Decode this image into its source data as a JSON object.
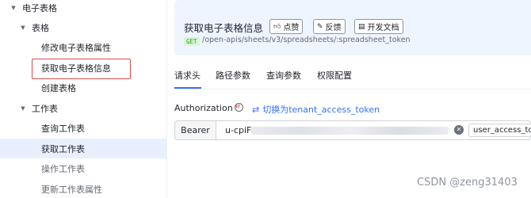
{
  "sidebar": {
    "items": [
      {
        "label": "电子表格",
        "arrow": "▼"
      },
      {
        "label": "表格",
        "arrow": "▼"
      },
      {
        "label": "修改电子表格属性"
      },
      {
        "label": "获取电子表格信息"
      },
      {
        "label": "创建表格"
      },
      {
        "label": "工作表",
        "arrow": "▼"
      },
      {
        "label": "查询工作表"
      },
      {
        "label": "获取工作表"
      },
      {
        "label": "操作工作表"
      },
      {
        "label": "更新工作表属性"
      }
    ]
  },
  "header": {
    "title": "获取电子表格信息",
    "buttons": {
      "like": {
        "label": "点赞",
        "icon": "thumbs-up-icon"
      },
      "feedback": {
        "label": "反馈",
        "icon": "feedback-icon"
      },
      "docs": {
        "label": "开发文档",
        "icon": "document-icon"
      }
    },
    "method": "GET",
    "path": "/open-apis/sheets/v3/spreadsheets/:spreadsheet_token"
  },
  "tabs": [
    {
      "label": "请求头",
      "active": true
    },
    {
      "label": "路径参数"
    },
    {
      "label": "查询参数"
    },
    {
      "label": "权限配置"
    }
  ],
  "auth": {
    "label": "Authorization",
    "required_mark": "*",
    "help": "?",
    "switch_label": "切换为tenant_access_token",
    "switch_icon": "⇄",
    "bearer": "Bearer",
    "token_prefix": "u-cpiF",
    "clear_icon": "✕",
    "token_type": "user_access_token"
  },
  "watermark": "CSDN @zeng31403",
  "colors": {
    "accent": "#3370ff",
    "selected_bg": "#e9f0fd",
    "highlight": "#d4504c",
    "header_bg": "#eef5ff"
  }
}
